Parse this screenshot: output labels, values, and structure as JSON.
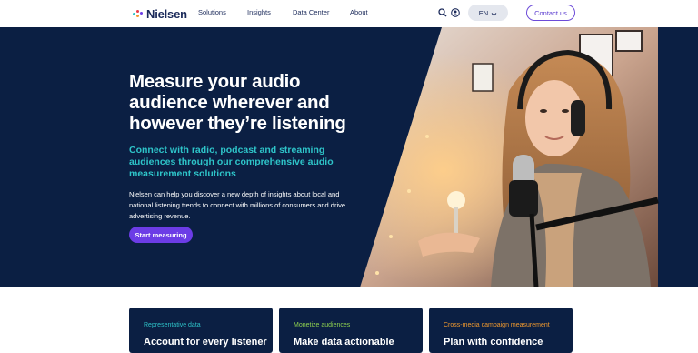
{
  "header": {
    "logo_text": "Nielsen",
    "nav": [
      "Solutions",
      "Insights",
      "Data Center",
      "About"
    ],
    "search_icon": "search-icon",
    "account_icon": "user-icon",
    "language": "EN",
    "language_icon": "arrow-down-icon",
    "contact_label": "Contact us"
  },
  "hero": {
    "title": "Measure your audio audience wherever and however they’re listening",
    "subtitle": "Connect with radio, podcast and streaming audiences through our comprehensive audio measurement solutions",
    "body": "Nielsen can help you discover a new depth of insights about local and national listening trends to connect with millions of consumers and drive advertising revenue.",
    "cta_label": "Start measuring"
  },
  "cards": [
    {
      "eyebrow": "Representative data",
      "title": "Account for every listener",
      "color": "#2ec4c9"
    },
    {
      "eyebrow": "Monetize audiences",
      "title": "Make data actionable",
      "color": "#8fd14f"
    },
    {
      "eyebrow": "Cross-media campaign measurement",
      "title": "Plan with confidence",
      "color": "#f29a2e"
    }
  ],
  "colors": {
    "brand_navy": "#0b1f43",
    "accent_purple": "#6c3ce6",
    "accent_teal": "#2ec4c9"
  }
}
